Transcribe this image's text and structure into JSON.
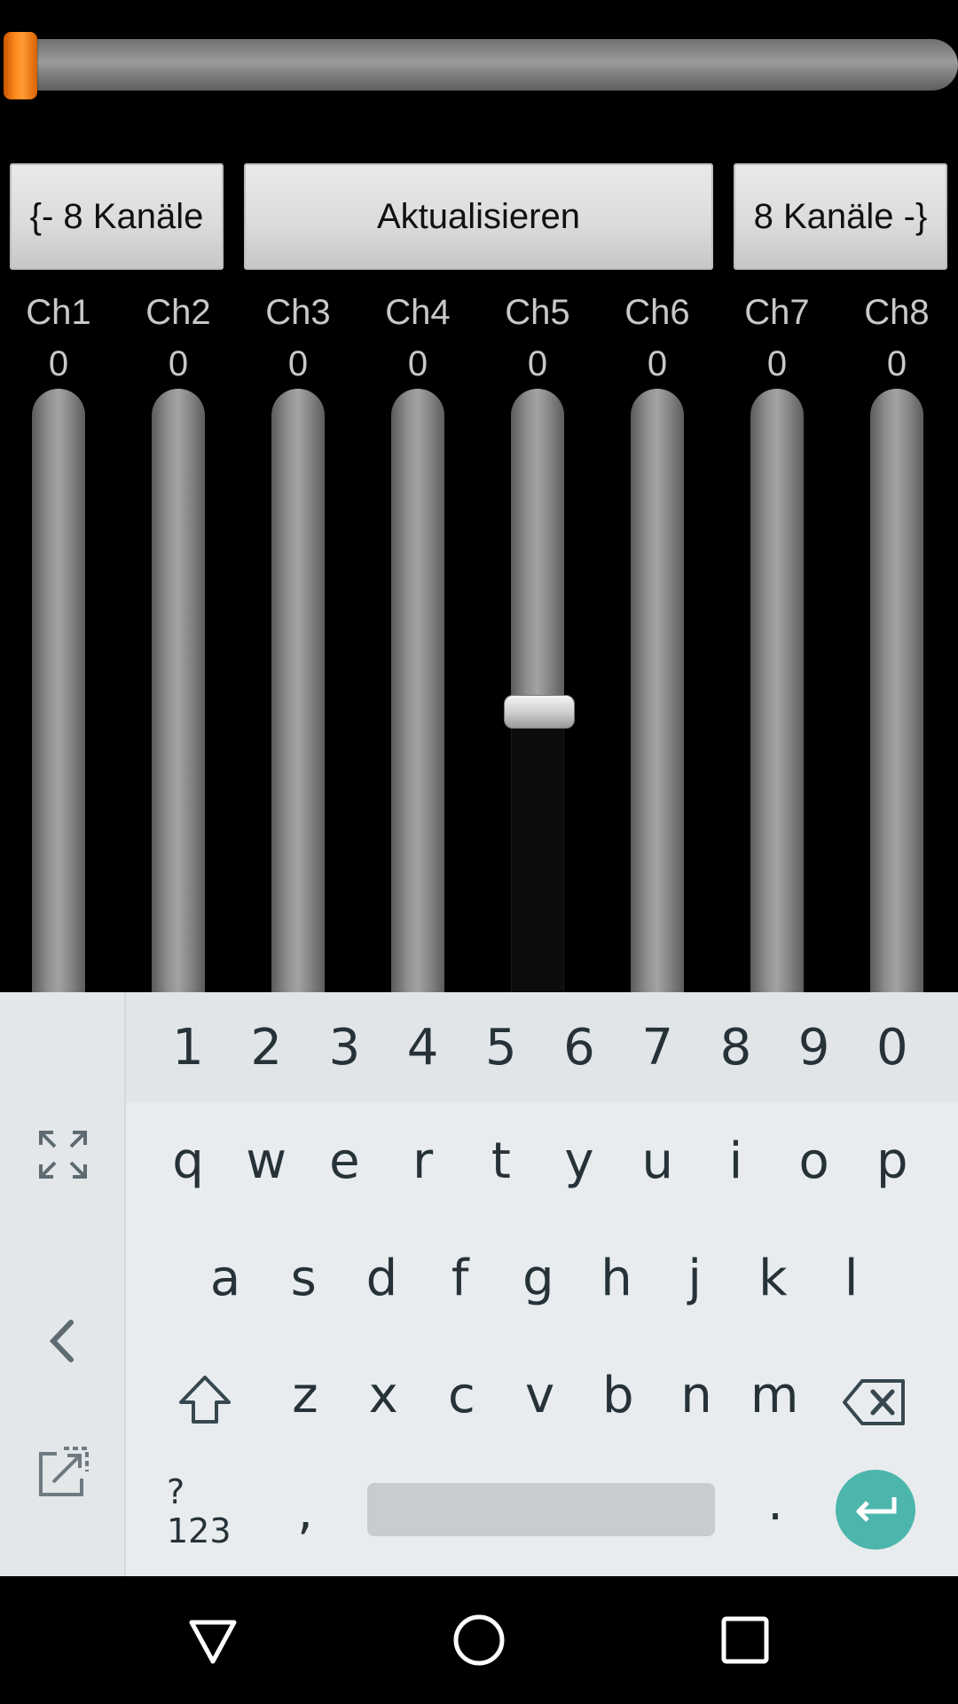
{
  "top_slider": {
    "value_fraction": 0.0
  },
  "buttons": {
    "prev": "{- 8 Kanäle",
    "update": "Aktualisieren",
    "next": "8 Kanäle -}"
  },
  "channels": [
    {
      "name": "Ch1",
      "value": "0"
    },
    {
      "name": "Ch2",
      "value": "0"
    },
    {
      "name": "Ch3",
      "value": "0"
    },
    {
      "name": "Ch4",
      "value": "0"
    },
    {
      "name": "Ch5",
      "value": "0"
    },
    {
      "name": "Ch6",
      "value": "0"
    },
    {
      "name": "Ch7",
      "value": "0"
    },
    {
      "name": "Ch8",
      "value": "0"
    }
  ],
  "active_channel_index": 4,
  "keyboard": {
    "numbers": [
      "1",
      "2",
      "3",
      "4",
      "5",
      "6",
      "7",
      "8",
      "9",
      "0"
    ],
    "row1": [
      "q",
      "w",
      "e",
      "r",
      "t",
      "y",
      "u",
      "i",
      "o",
      "p"
    ],
    "row2": [
      "a",
      "s",
      "d",
      "f",
      "g",
      "h",
      "j",
      "k",
      "l"
    ],
    "row3": [
      "z",
      "x",
      "c",
      "v",
      "b",
      "n",
      "m"
    ],
    "symbols_label": "?123",
    "comma": ",",
    "period": "."
  },
  "colors": {
    "accent_orange": "#ff8a1c",
    "enter_teal": "#4db6ac",
    "keyboard_bg": "#e8ecef"
  },
  "icons": {
    "side_top": "expand-icon",
    "side_mid": "chevron-left-icon",
    "side_bottom": "popout-icon",
    "shift": "shift-icon",
    "backspace": "backspace-icon",
    "enter": "enter-icon",
    "nav_back": "back-triangle-icon",
    "nav_home": "home-circle-icon",
    "nav_recents": "recents-square-icon"
  }
}
